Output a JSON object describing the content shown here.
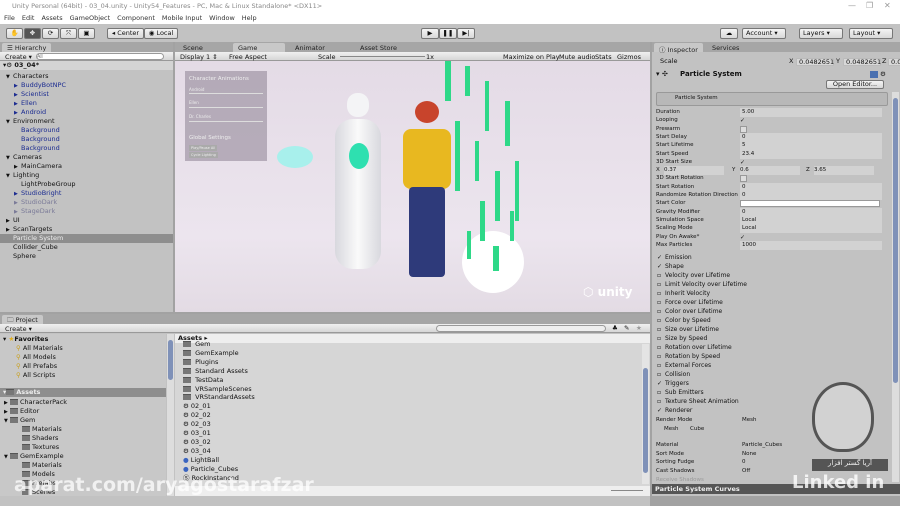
{
  "window": {
    "title": "Unity Personal (64bit) - 03_04.unity - Unity54_Features - PC, Mac & Linux Standalone* <DX11>",
    "minimize": "—",
    "maximize": "❐",
    "close": "✕"
  },
  "menu": [
    "File",
    "Edit",
    "Assets",
    "GameObject",
    "Component",
    "Mobile Input",
    "Window",
    "Help"
  ],
  "toolbar": {
    "center": "Center",
    "local": "Local",
    "account": "Account",
    "layers": "Layers",
    "layout": "Layout"
  },
  "hierarchy": {
    "tab": "Hierarchy",
    "create": "Create",
    "search_placeholder": "All",
    "scene": "03_04*",
    "items": [
      {
        "label": "Characters",
        "indent": 1,
        "arrow": "▼",
        "style": ""
      },
      {
        "label": "BuddyBotNPC",
        "indent": 2,
        "arrow": "▶",
        "style": "blue"
      },
      {
        "label": "Scientist",
        "indent": 2,
        "arrow": "▶",
        "style": "blue"
      },
      {
        "label": "Ellen",
        "indent": 2,
        "arrow": "▶",
        "style": "blue"
      },
      {
        "label": "Android",
        "indent": 2,
        "arrow": "▶",
        "style": "blue"
      },
      {
        "label": "Environment",
        "indent": 1,
        "arrow": "▼",
        "style": ""
      },
      {
        "label": "Background",
        "indent": 2,
        "arrow": "",
        "style": "blue"
      },
      {
        "label": "Background",
        "indent": 2,
        "arrow": "",
        "style": "blue"
      },
      {
        "label": "Background",
        "indent": 2,
        "arrow": "",
        "style": "blue"
      },
      {
        "label": "Cameras",
        "indent": 1,
        "arrow": "▼",
        "style": ""
      },
      {
        "label": "MainCamera",
        "indent": 2,
        "arrow": "▶",
        "style": ""
      },
      {
        "label": "Lighting",
        "indent": 1,
        "arrow": "▼",
        "style": ""
      },
      {
        "label": "LightProbeGroup",
        "indent": 2,
        "arrow": "",
        "style": ""
      },
      {
        "label": "StudioBright",
        "indent": 2,
        "arrow": "▶",
        "style": "blue"
      },
      {
        "label": "StudioDark",
        "indent": 2,
        "arrow": "▶",
        "style": "grey"
      },
      {
        "label": "StageDark",
        "indent": 2,
        "arrow": "▶",
        "style": "grey"
      },
      {
        "label": "UI",
        "indent": 1,
        "arrow": "▶",
        "style": ""
      },
      {
        "label": "ScanTargets",
        "indent": 1,
        "arrow": "▶",
        "style": ""
      },
      {
        "label": "Particle System",
        "indent": 1,
        "arrow": "",
        "style": "sel"
      },
      {
        "label": "Collider_Cube",
        "indent": 1,
        "arrow": "",
        "style": ""
      },
      {
        "label": "Sphere",
        "indent": 1,
        "arrow": "",
        "style": ""
      }
    ]
  },
  "center_tabs": [
    "Scene",
    "Game",
    "Animator",
    "Asset Store"
  ],
  "game": {
    "display": "Display 1",
    "aspect": "Free Aspect",
    "scale_label": "Scale",
    "scale_value": "1x",
    "maximize": "Maximize on Play",
    "mute": "Mute audio",
    "stats": "Stats",
    "gizmos": "Gizmos",
    "overlay": {
      "title": "Character Animations",
      "labels": [
        "Android",
        "Ellen",
        "Dr. Charles"
      ],
      "global": "Global Settings",
      "buttons": [
        "Play/Pause All",
        "Cycle Lighting"
      ]
    },
    "logo": "unity"
  },
  "inspector": {
    "tabs": [
      "Inspector",
      "Services"
    ],
    "scale_label": "Scale",
    "scale": {
      "x": "0.0482651",
      "y": "0.0482651",
      "z": "0.0482651"
    },
    "component": "Particle System",
    "open_editor": "Open Editor...",
    "module": "Particle System",
    "props": [
      {
        "label": "Duration",
        "value": "5.00"
      },
      {
        "label": "Looping",
        "check": true
      },
      {
        "label": "Prewarm",
        "check": false
      },
      {
        "label": "Start Delay",
        "value": "0"
      },
      {
        "label": "Start Lifetime",
        "value": "5"
      },
      {
        "label": "Start Speed",
        "value": "23.4"
      },
      {
        "label": "3D Start Size",
        "check": true
      }
    ],
    "size_xyz": {
      "x": "0.37",
      "y": "0.6",
      "z": "3.65"
    },
    "props2": [
      {
        "label": "3D Start Rotation",
        "check": false
      },
      {
        "label": "Start Rotation",
        "value": "0"
      },
      {
        "label": "Randomize Rotation Direction",
        "value": "0"
      },
      {
        "label": "Start Color",
        "value": ""
      },
      {
        "label": "Gravity Modifier",
        "value": "0"
      },
      {
        "label": "Simulation Space",
        "value": "Local"
      },
      {
        "label": "Scaling Mode",
        "value": "Local"
      },
      {
        "label": "Play On Awake*",
        "check": true
      },
      {
        "label": "Max Particles",
        "value": "1000"
      }
    ],
    "modules": [
      {
        "label": "Emission",
        "on": true
      },
      {
        "label": "Shape",
        "on": true
      },
      {
        "label": "Velocity over Lifetime",
        "on": false
      },
      {
        "label": "Limit Velocity over Lifetime",
        "on": false
      },
      {
        "label": "Inherit Velocity",
        "on": false
      },
      {
        "label": "Force over Lifetime",
        "on": false
      },
      {
        "label": "Color over Lifetime",
        "on": false
      },
      {
        "label": "Color by Speed",
        "on": false
      },
      {
        "label": "Size over Lifetime",
        "on": false
      },
      {
        "label": "Size by Speed",
        "on": false
      },
      {
        "label": "Rotation over Lifetime",
        "on": false
      },
      {
        "label": "Rotation by Speed",
        "on": false
      },
      {
        "label": "External Forces",
        "on": false
      },
      {
        "label": "Collision",
        "on": false
      },
      {
        "label": "Triggers",
        "on": true
      },
      {
        "label": "Sub Emitters",
        "on": false
      },
      {
        "label": "Texture Sheet Animation",
        "on": false
      },
      {
        "label": "Renderer",
        "on": true
      }
    ],
    "renderer": [
      {
        "label": "Render Mode",
        "value": "Mesh"
      },
      {
        "label": "Mesh",
        "value": "Cube"
      },
      {
        "label": "Material",
        "value": "Particle_Cubes"
      },
      {
        "label": "Sort Mode",
        "value": "None"
      },
      {
        "label": "Sorting Fudge",
        "value": "0"
      },
      {
        "label": "Cast Shadows",
        "value": "Off"
      },
      {
        "label": "Receive Shadows",
        "value": ""
      }
    ],
    "curves": "Particle System Curves"
  },
  "project": {
    "tab": "Project",
    "create": "Create",
    "favorites": "Favorites",
    "fav_items": [
      "All Materials",
      "All Models",
      "All Prefabs",
      "All Scripts"
    ],
    "assets_root": "Assets",
    "tree": [
      {
        "label": "CharacterPack",
        "indent": 1,
        "arrow": "▶"
      },
      {
        "label": "Editor",
        "indent": 1,
        "arrow": "▶"
      },
      {
        "label": "Gem",
        "indent": 1,
        "arrow": "▼"
      },
      {
        "label": "Materials",
        "indent": 2,
        "arrow": ""
      },
      {
        "label": "Shaders",
        "indent": 2,
        "arrow": ""
      },
      {
        "label": "Textures",
        "indent": 2,
        "arrow": ""
      },
      {
        "label": "GemExample",
        "indent": 1,
        "arrow": "▼"
      },
      {
        "label": "Materials",
        "indent": 2,
        "arrow": ""
      },
      {
        "label": "Models",
        "indent": 2,
        "arrow": ""
      },
      {
        "label": "Prefabs",
        "indent": 2,
        "arrow": ""
      },
      {
        "label": "Scenes",
        "indent": 2,
        "arrow": ""
      }
    ],
    "breadcrumb": "Assets",
    "files": [
      {
        "label": "Gem",
        "type": "folder"
      },
      {
        "label": "GemExample",
        "type": "folder"
      },
      {
        "label": "Plugins",
        "type": "folder"
      },
      {
        "label": "Standard Assets",
        "type": "folder"
      },
      {
        "label": "TestData",
        "type": "folder"
      },
      {
        "label": "VRSampleScenes",
        "type": "folder"
      },
      {
        "label": "VRStandardAssets",
        "type": "folder"
      },
      {
        "label": "02_01",
        "type": "scene"
      },
      {
        "label": "02_02",
        "type": "scene"
      },
      {
        "label": "02_03",
        "type": "scene"
      },
      {
        "label": "03_01",
        "type": "scene"
      },
      {
        "label": "03_02",
        "type": "scene"
      },
      {
        "label": "03_04",
        "type": "scene"
      },
      {
        "label": "LightBall",
        "type": "material"
      },
      {
        "label": "Particle_Cubes",
        "type": "material"
      },
      {
        "label": "RockInstanced",
        "type": "script"
      }
    ]
  },
  "watermarks": {
    "aparat": "aparat.com/aryagostarafzar",
    "linkedin": "Linked in",
    "logo_text": "آریا گستر افزار"
  }
}
